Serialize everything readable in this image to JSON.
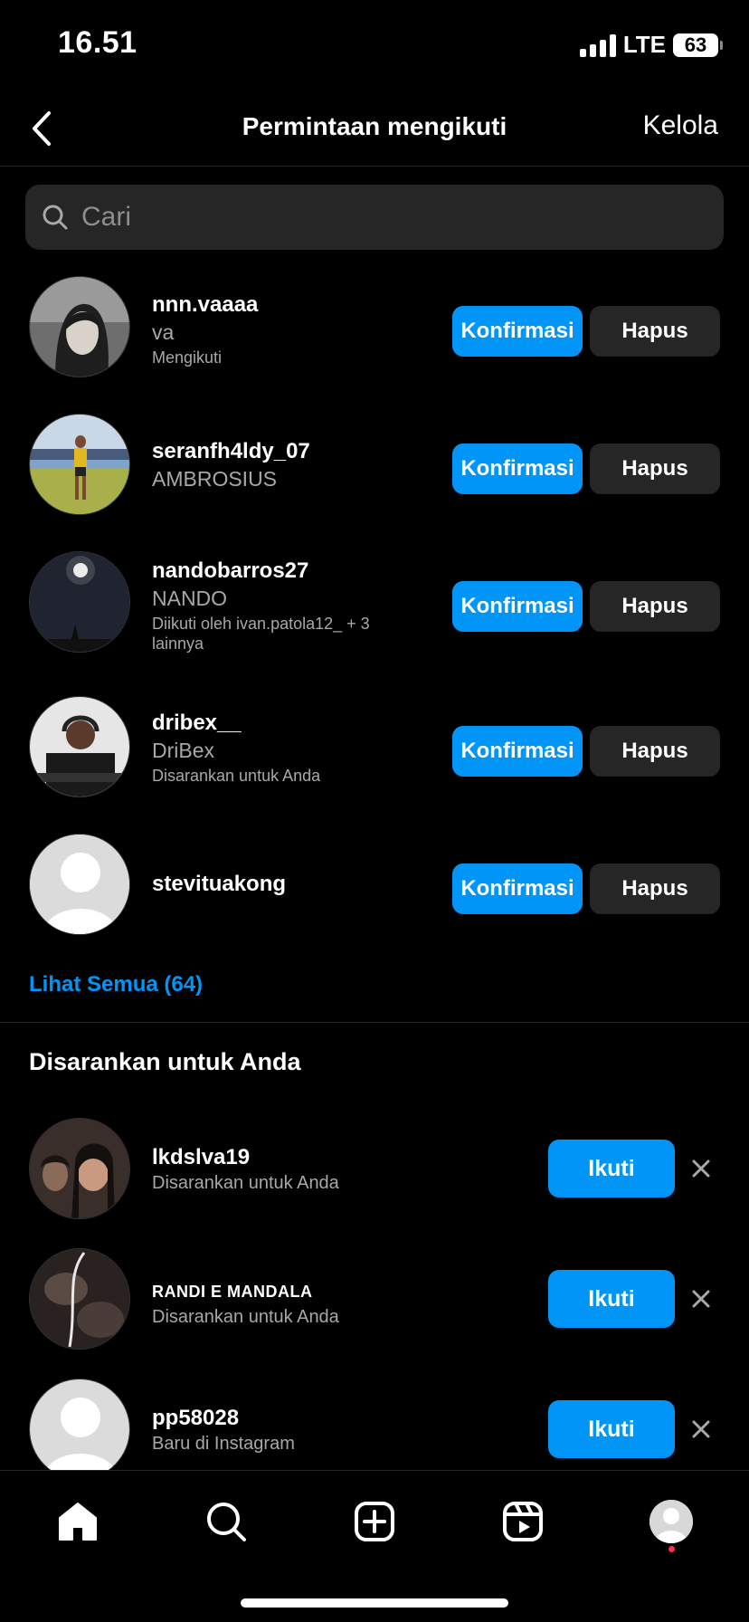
{
  "status_bar": {
    "time": "16.51",
    "network": "LTE",
    "battery": "63"
  },
  "header": {
    "title": "Permintaan mengikuti",
    "manage_label": "Kelola"
  },
  "search": {
    "placeholder": "Cari"
  },
  "requests": [
    {
      "username": "nnn.vaaaa",
      "fullname": "va",
      "subtext": "Mengikuti"
    },
    {
      "username": "seranfh4ldy_07",
      "fullname": "AMBROSIUS",
      "subtext": ""
    },
    {
      "username": "nandobarros27",
      "fullname": "NANDO",
      "subtext": "Diikuti oleh ivan.patola12_ + 3 lainnya"
    },
    {
      "username": "dribex__",
      "fullname": "DriBex",
      "subtext": "Disarankan untuk Anda"
    },
    {
      "username": "stevituakong",
      "fullname": "",
      "subtext": ""
    }
  ],
  "request_actions": {
    "confirm_label": "Konfirmasi",
    "delete_label": "Hapus"
  },
  "see_all_label": "Lihat Semua (64)",
  "suggestions": {
    "title": "Disarankan untuk Anda",
    "follow_label": "Ikuti",
    "items": [
      {
        "username": "lkdslva19",
        "subtext": "Disarankan untuk Anda"
      },
      {
        "username": "RANDI E MANDALA",
        "subtext": "Disarankan untuk Anda"
      },
      {
        "username": "pp58028",
        "subtext": "Baru di Instagram"
      }
    ]
  },
  "tabbar": {
    "items": [
      "home-icon",
      "search-icon",
      "create-icon",
      "reels-icon",
      "profile-avatar"
    ]
  },
  "colors": {
    "accent": "#0095f6",
    "background": "#000000",
    "secondary_button": "#262626",
    "muted_text": "#a8a8a8",
    "notification": "#ff3040"
  }
}
